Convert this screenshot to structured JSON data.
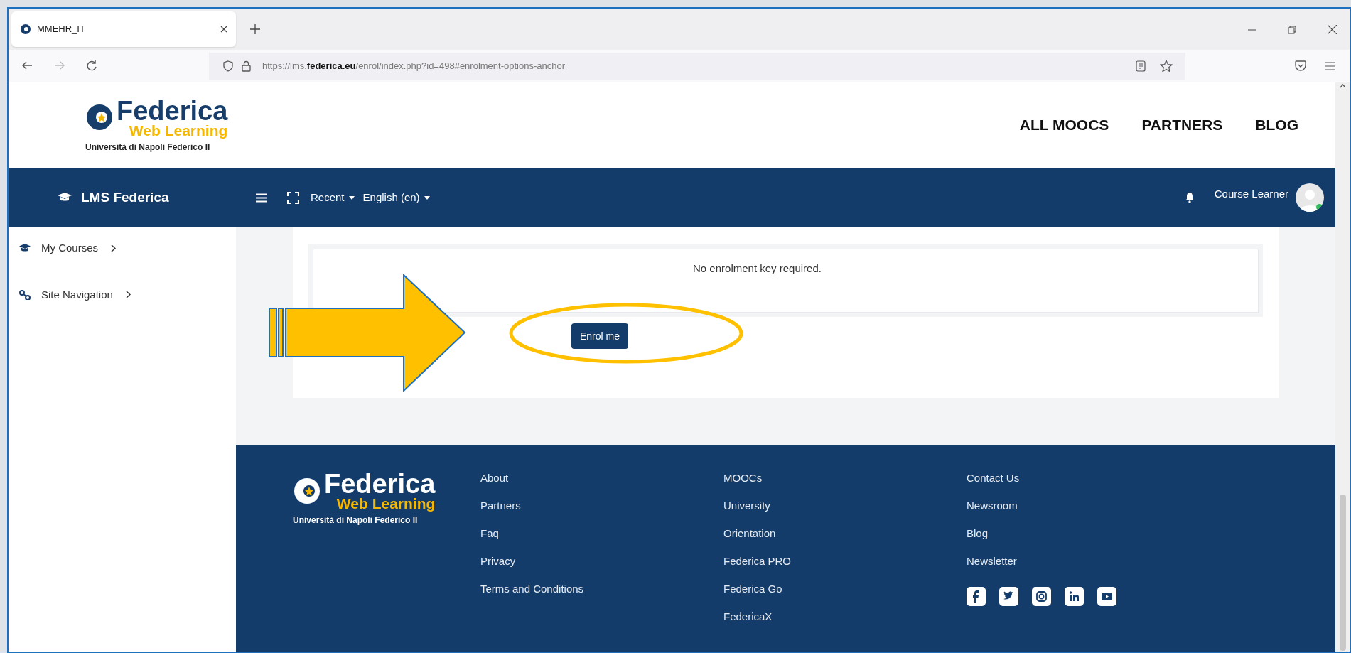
{
  "browser": {
    "tab": {
      "title": "MMEHR_IT",
      "selected": true
    },
    "url": "https://lms.**federica.eu**/enrol/index.php?id=498#enrolment-options-anchor"
  },
  "header": {
    "logo": {
      "name": "Federica",
      "tagline": "Web Learning",
      "university": "Università di Napoli Federico II"
    },
    "nav": [
      "ALL MOOCS",
      "PARTNERS",
      "BLOG"
    ]
  },
  "navbar": {
    "brand": "LMS Federica",
    "menus": [
      "Recent",
      "English (en)"
    ],
    "user": "Course Learner"
  },
  "sidebar": {
    "items": [
      {
        "label": "My Courses"
      },
      {
        "label": "Site Navigation"
      }
    ]
  },
  "enrolment": {
    "message": "No enrolment key required.",
    "button": "Enrol me"
  },
  "footer": {
    "logo": {
      "name": "Federica",
      "tagline": "Web Learning",
      "university": "Università di Napoli Federico II"
    },
    "columns": [
      [
        "About",
        "Partners",
        "Faq",
        "Privacy",
        "Terms and Conditions"
      ],
      [
        "MOOCs",
        "University",
        "Orientation",
        "Federica PRO",
        "Federica Go",
        "FedericaX"
      ],
      [
        "Contact Us",
        "Newsroom",
        "Blog",
        "Newsletter"
      ]
    ]
  }
}
